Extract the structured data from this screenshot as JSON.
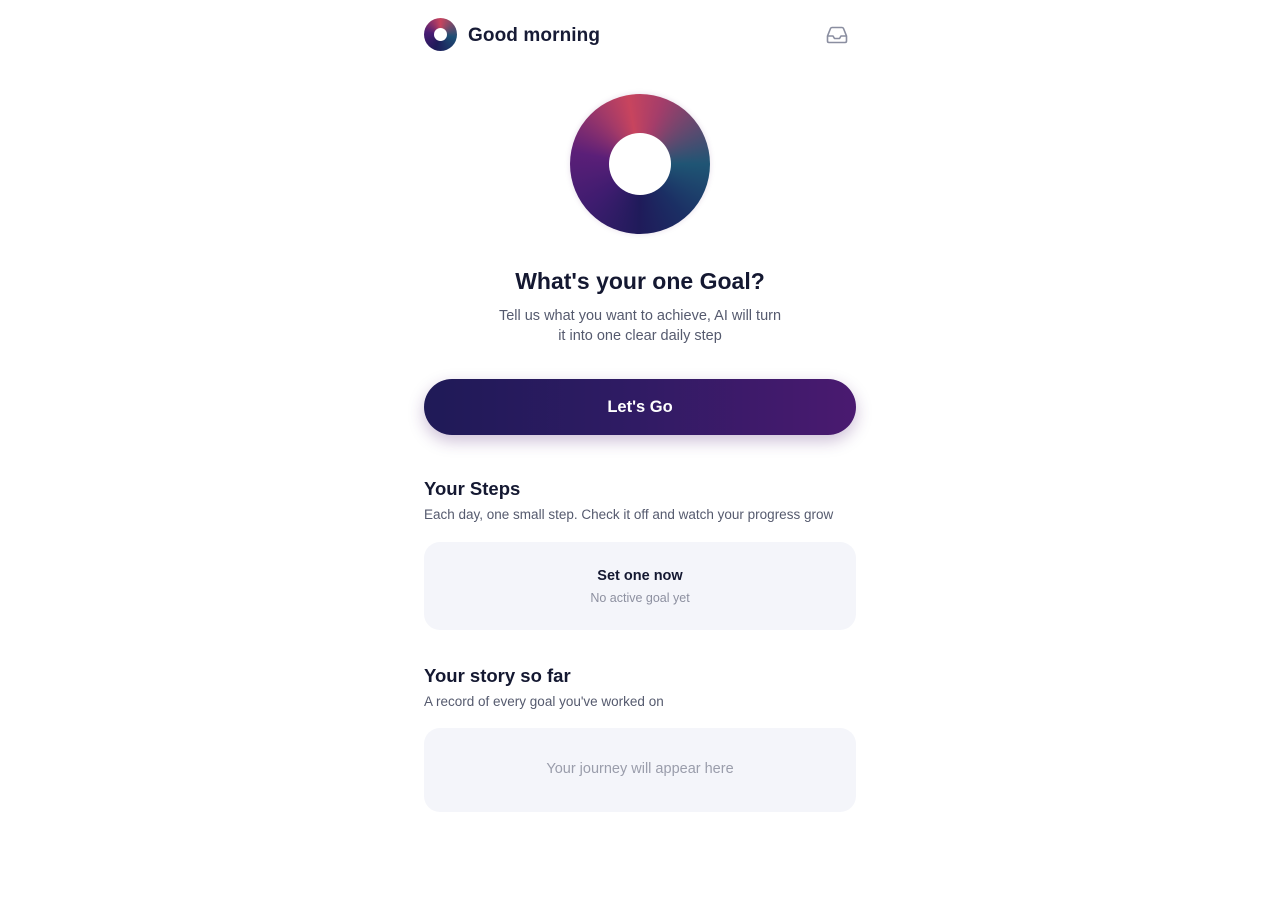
{
  "header": {
    "greeting": "Good morning",
    "logo_icon": "app-logo-ring",
    "inbox_icon": "inbox-icon"
  },
  "hero": {
    "icon": "goal-ring-icon",
    "title": "What's your one Goal?",
    "subtitle_line1": "Tell us what you want to achieve, AI will turn",
    "subtitle_line2": "it into one clear daily step",
    "cta_label": "Let's Go"
  },
  "steps": {
    "title": "Your Steps",
    "subtitle": "Each day, one small step. Check it off and watch your progress grow",
    "card_title": "Set one now",
    "card_subtitle": "No active goal yet"
  },
  "story": {
    "title": "Your story so far",
    "subtitle": "A record of every goal you've worked on",
    "empty_text": "Your journey will appear here"
  },
  "colors": {
    "accent_dark": "#1f1a57",
    "accent_purple": "#4a1a70",
    "accent_rose": "#c8445e",
    "card_bg": "#f4f5fa"
  }
}
